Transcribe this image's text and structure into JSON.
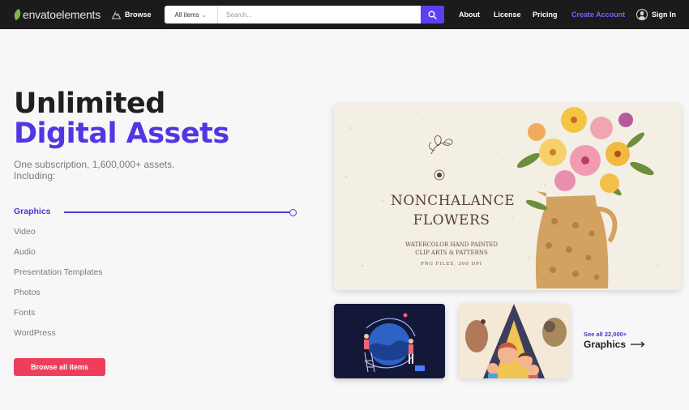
{
  "header": {
    "logo_text": "envatoelements",
    "browse_label": "Browse",
    "search": {
      "category": "All items",
      "placeholder": "Search..."
    },
    "nav": {
      "about": "About",
      "license": "License",
      "pricing": "Pricing",
      "create_account": "Create Account",
      "sign_in": "Sign In"
    },
    "accent_color": "#6f67ff",
    "search_button_color": "#5d3ff0"
  },
  "hero": {
    "title_line1": "Unlimited",
    "title_line2": "Digital Assets",
    "subtitle": "One subscription, 1,600,000+ assets. Including:",
    "brand_color": "#5435e3"
  },
  "categories": {
    "items": [
      "Graphics",
      "Video",
      "Audio",
      "Presentation Templates",
      "Photos",
      "Fonts",
      "WordPress"
    ],
    "active": "Graphics"
  },
  "cta": {
    "label": "Browse all items",
    "color": "#ee3e5b"
  },
  "featured": {
    "title_line1": "NONCHALANCE",
    "title_line2": "FLOWERS",
    "subtitle_line1": "WATERCOLOR HAND PAINTED",
    "subtitle_line2": "CLIP ARTS & PATTERNS",
    "files_note": "PNG FILES, 300 DPI"
  },
  "see_all": {
    "count_text": "See all 22,000+",
    "category": "Graphics"
  }
}
